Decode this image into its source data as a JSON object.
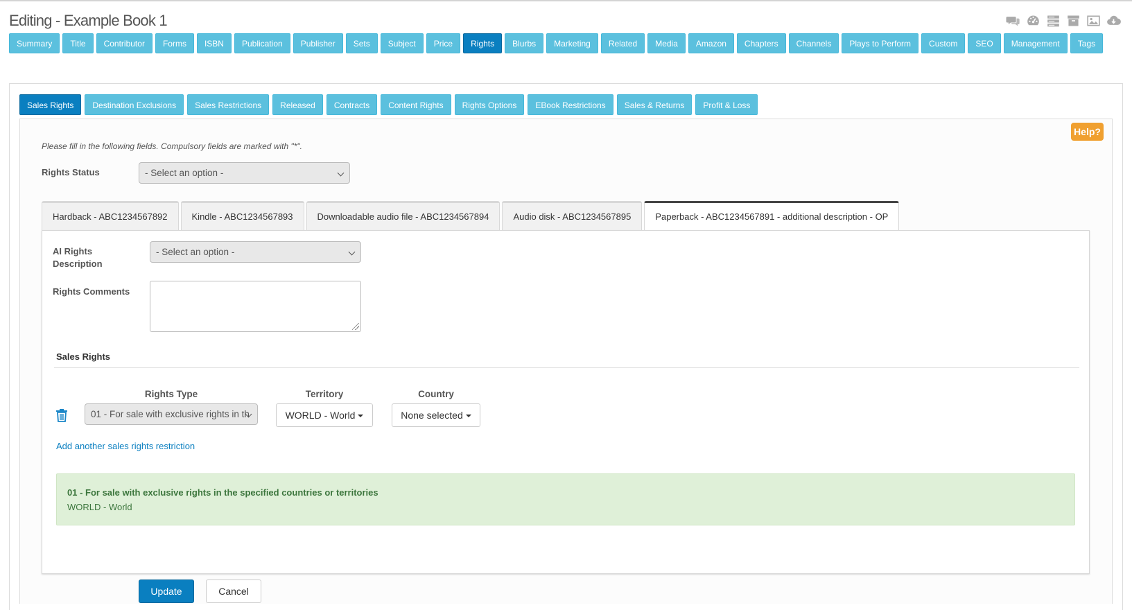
{
  "page": {
    "title": "Editing - Example Book 1"
  },
  "header_icons": [
    "comments-icon",
    "dashboard-icon",
    "list-icon",
    "archive-icon",
    "image-icon",
    "cloud-download-icon"
  ],
  "main_tabs": [
    "Summary",
    "Title",
    "Contributor",
    "Forms",
    "ISBN",
    "Publication",
    "Publisher",
    "Sets",
    "Subject",
    "Price",
    "Rights",
    "Blurbs",
    "Marketing",
    "Related",
    "Media",
    "Amazon",
    "Chapters",
    "Channels",
    "Plays to Perform",
    "Custom",
    "SEO",
    "Management",
    "Tags"
  ],
  "active_main_tab": "Rights",
  "sub_tabs": [
    "Sales Rights",
    "Destination Exclusions",
    "Sales Restrictions",
    "Released",
    "Contracts",
    "Content Rights",
    "Rights Options",
    "EBook Restrictions",
    "Sales & Returns",
    "Profit & Loss"
  ],
  "active_sub_tab": "Sales Rights",
  "help_label": "Help?",
  "instructions": "Please fill in the following fields. Compulsory fields are marked with \"*\".",
  "rights_status": {
    "label": "Rights Status",
    "value": "- Select an option -"
  },
  "format_tabs": [
    "Hardback - ABC1234567892",
    "Kindle - ABC1234567893",
    "Downloadable audio file - ABC1234567894",
    "Audio disk - ABC1234567895",
    "Paperback - ABC1234567891 - additional description - OP"
  ],
  "active_format_tab": "Paperback - ABC1234567891 - additional description - OP",
  "ai_rights": {
    "label_line1": "AI Rights",
    "label_line2": "Description",
    "value": "- Select an option -"
  },
  "rights_comments": {
    "label": "Rights Comments",
    "value": ""
  },
  "sales_rights": {
    "title": "Sales Rights",
    "col_rights_type": "Rights Type",
    "col_territory": "Territory",
    "col_country": "Country",
    "row": {
      "rights_type": "01 - For sale with exclusive rights in th",
      "territory": "WORLD - World",
      "country": "None selected"
    },
    "add_link": "Add another sales rights restriction",
    "summary_title": "01 - For sale with exclusive rights in the specified countries or territories",
    "summary_sub": "WORLD - World"
  },
  "buttons": {
    "update": "Update",
    "cancel": "Cancel"
  },
  "colors": {
    "tab": "#5bc0de",
    "tab_active": "#0a7fc0",
    "help": "#f0a030",
    "success_bg": "#dff0d8"
  }
}
